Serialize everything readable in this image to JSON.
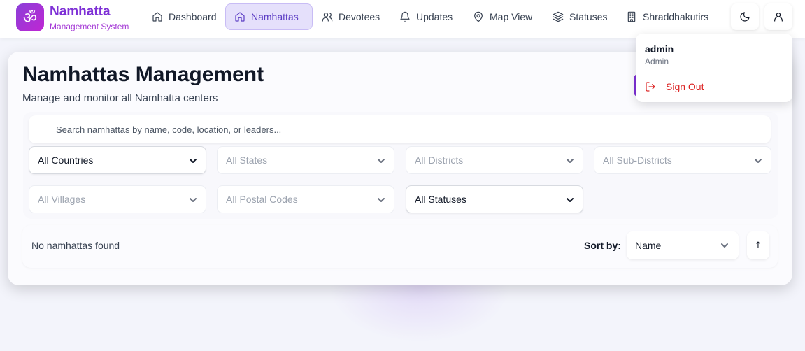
{
  "brand": {
    "logo_glyph": "ॐ",
    "title": "Namhatta",
    "subtitle": "Management System"
  },
  "nav": {
    "items": [
      {
        "label": "Dashboard",
        "icon": "home-icon",
        "active": false
      },
      {
        "label": "Namhattas",
        "icon": "home-icon",
        "active": true
      },
      {
        "label": "Devotees",
        "icon": "users-icon",
        "active": false
      },
      {
        "label": "Updates",
        "icon": "bell-icon",
        "active": false
      },
      {
        "label": "Map View",
        "icon": "map-pin-icon",
        "active": false
      },
      {
        "label": "Statuses",
        "icon": "layers-icon",
        "active": false
      },
      {
        "label": "Shraddhakutirs",
        "icon": "building-icon",
        "active": false
      }
    ],
    "theme_toggle_icon": "moon-icon",
    "user_icon": "user-icon"
  },
  "page": {
    "title": "Namhattas Management",
    "subtitle": "Manage and monitor all Namhatta centers"
  },
  "search": {
    "placeholder": "Search namhattas by name, code, location, or leaders...",
    "value": ""
  },
  "filters": {
    "countries": "All Countries",
    "states": "All States",
    "districts": "All Districts",
    "sub_districts": "All Sub-Districts",
    "villages": "All Villages",
    "postal_codes": "All Postal Codes",
    "statuses": "All Statuses"
  },
  "results": {
    "empty_message": "No namhattas found",
    "sort_label": "Sort by:",
    "sort_value": "Name",
    "sort_direction": "↑"
  },
  "user_menu": {
    "name": "admin",
    "role": "Admin",
    "sign_out_label": "Sign Out"
  },
  "colors": {
    "brand_purple": "#7e30d6",
    "active_nav_bg": "#e5e0fb",
    "danger": "#dc2626"
  }
}
